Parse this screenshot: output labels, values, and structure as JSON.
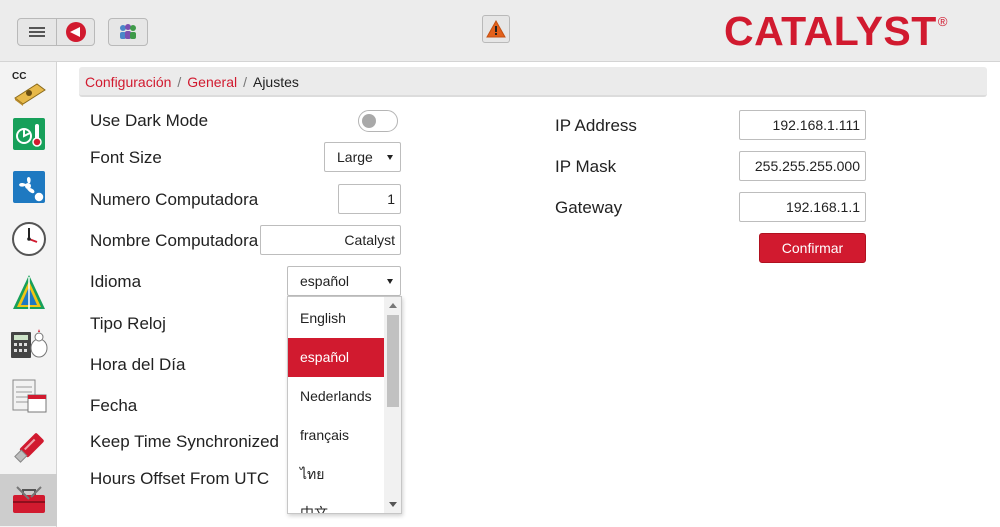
{
  "header": {
    "brand": "CATALYST",
    "brand_mark": "®",
    "icons": [
      "menu-icon",
      "back-icon",
      "users-icon",
      "warning-icon"
    ]
  },
  "sidebar": {
    "items": [
      {
        "name": "cc-icon",
        "label": "CC"
      },
      {
        "name": "climate-icon"
      },
      {
        "name": "fan-icon"
      },
      {
        "name": "clock-icon"
      },
      {
        "name": "growth-chart-icon"
      },
      {
        "name": "calculator-icon"
      },
      {
        "name": "calendar-icon"
      },
      {
        "name": "usb-icon"
      },
      {
        "name": "toolbox-icon",
        "active": true
      }
    ]
  },
  "breadcrumb": {
    "items": [
      "Configuración",
      "General"
    ],
    "separator": "/",
    "current": "Ajustes"
  },
  "settings": {
    "dark_mode_label": "Use Dark Mode",
    "dark_mode_on": false,
    "font_size_label": "Font Size",
    "font_size_value": "Large",
    "computer_number_label": "Numero Computadora",
    "computer_number_value": "1",
    "computer_name_label": "Nombre Computadora",
    "computer_name_value": "Catalyst",
    "language_label": "Idioma",
    "language_value": "español",
    "clock_type_label": "Tipo Reloj",
    "time_of_day_label": "Hora del Día",
    "date_label": "Fecha",
    "keep_sync_label": "Keep Time Synchronized",
    "utc_offset_label": "Hours Offset From UTC"
  },
  "language_dropdown": {
    "options": [
      "English",
      "español",
      "Nederlands",
      "français",
      "ไทย",
      "中文"
    ],
    "selected_index": 1
  },
  "network": {
    "ip_address_label": "IP Address",
    "ip_address_value": "192.168.1.111",
    "ip_mask_label": "IP Mask",
    "ip_mask_value": "255.255.255.000",
    "gateway_label": "Gateway",
    "gateway_value": "192.168.1.1",
    "confirm_label": "Confirmar"
  },
  "colors": {
    "accent": "#d11a2f"
  }
}
